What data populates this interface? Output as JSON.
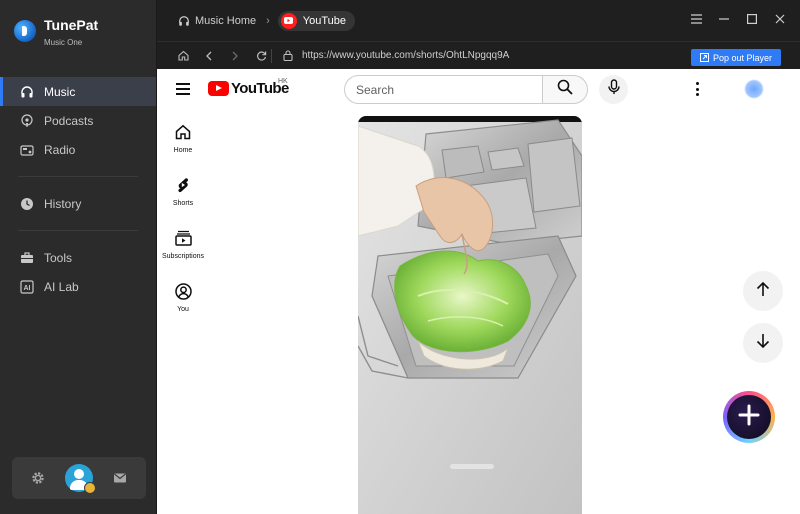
{
  "app": {
    "name": "TunePat",
    "subtitle": "Music One"
  },
  "sidebar": {
    "items": [
      {
        "label": "Music",
        "icon": "headphones-icon",
        "active": true
      },
      {
        "label": "Podcasts",
        "icon": "podcast-icon",
        "active": false
      },
      {
        "label": "Radio",
        "icon": "radio-icon",
        "active": false
      },
      {
        "label": "History",
        "icon": "clock-icon",
        "active": false
      },
      {
        "label": "Tools",
        "icon": "toolbox-icon",
        "active": false
      },
      {
        "label": "AI Lab",
        "icon": "ai-icon",
        "active": false
      }
    ],
    "bottom": {
      "settings_icon": "gear-icon",
      "avatar_icon": "user-avatar-icon",
      "mail_icon": "mail-icon"
    }
  },
  "titlebar": {
    "home_label": "Music Home",
    "current_tab": "YouTube"
  },
  "addressbar": {
    "url": "https://www.youtube.com/shorts/OhtLNpgqq9A",
    "popout_label": "Pop out Player"
  },
  "youtube": {
    "logo_text": "YouTube",
    "region": "HK",
    "search_placeholder": "Search",
    "side_nav": [
      {
        "label": "Home",
        "icon": "home-icon"
      },
      {
        "label": "Shorts",
        "icon": "shorts-icon"
      },
      {
        "label": "Subscriptions",
        "icon": "subscriptions-icon"
      },
      {
        "label": "You",
        "icon": "you-icon"
      }
    ]
  },
  "colors": {
    "accent": "#2f7bf5",
    "youtube_red": "#ff0000",
    "sidebar_bg": "#2b2b2b",
    "titlebar_bg": "#1f1f1f"
  }
}
